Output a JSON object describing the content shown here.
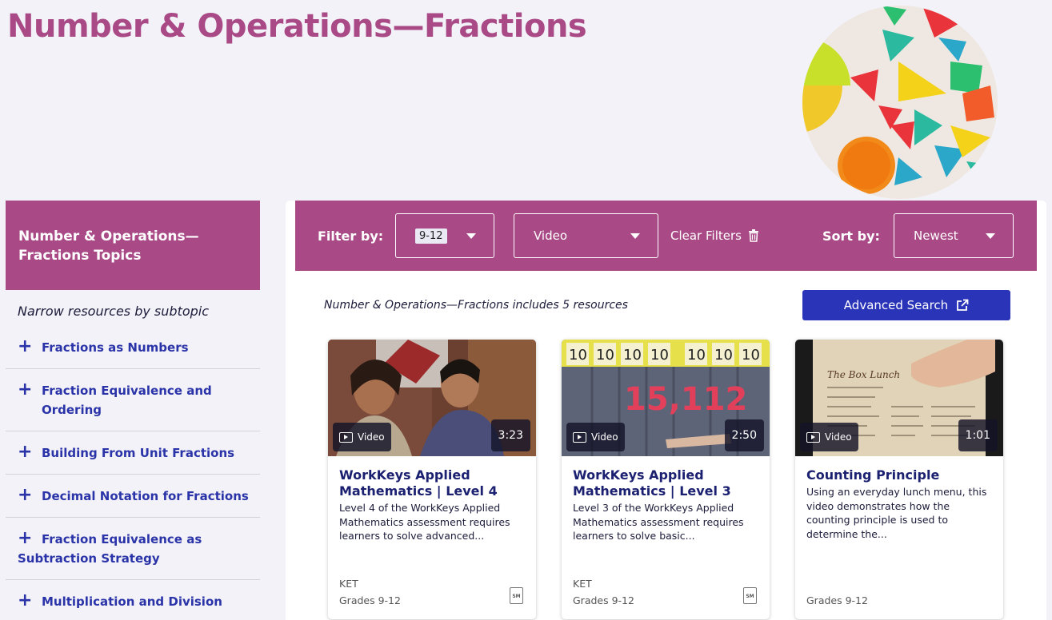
{
  "page": {
    "title": "Number & Operations—Fractions"
  },
  "sidebar": {
    "heading": "Number & Operations—Fractions Topics",
    "subheading": "Narrow resources by subtopic",
    "topics": [
      "Fractions as Numbers",
      "Fraction Equivalence and Ordering",
      "Building From Unit Fractions",
      "Decimal Notation for Fractions",
      "Fraction Equivalence as Subtraction Strategy",
      "Multiplication and Division"
    ]
  },
  "filters": {
    "filter_label": "Filter by:",
    "grade_value": "9-12",
    "type_value": "Video",
    "clear_label": "Clear Filters",
    "sort_label": "Sort by:",
    "sort_value": "Newest"
  },
  "results": {
    "count_text": "Number & Operations—Fractions includes 5 resources",
    "advanced_search_label": "Advanced Search"
  },
  "cards": [
    {
      "type_label": "Video",
      "duration": "3:23",
      "title": "WorkKeys Applied Mathematics | Level 4",
      "description": "Level 4 of the WorkKeys Applied Mathematics assessment requires learners to solve advanced...",
      "source": "KET",
      "grades": "Grades 9-12",
      "doc_badge": "SM"
    },
    {
      "type_label": "Video",
      "duration": "2:50",
      "title": "WorkKeys Applied Mathematics | Level 3",
      "description": "Level 3 of the WorkKeys Applied Mathematics assessment requires learners to solve basic...",
      "source": "KET",
      "grades": "Grades 9-12",
      "doc_badge": "SM"
    },
    {
      "type_label": "Video",
      "duration": "1:01",
      "title": "Counting Principle",
      "description": "Using an everyday lunch menu, this video demonstrates how the counting principle is used to determine the...",
      "source": "",
      "grades": "Grades 9-12"
    }
  ],
  "thumb2": {
    "number": "15,112",
    "place_values": [
      "10",
      "10",
      "10",
      "10",
      "10",
      "10",
      "10"
    ]
  },
  "thumb3": {
    "menu_title": "The Box Lunch"
  },
  "colors": {
    "brand": "#a94a87",
    "accent": "#2a34b8",
    "link": "#2a34a8"
  }
}
